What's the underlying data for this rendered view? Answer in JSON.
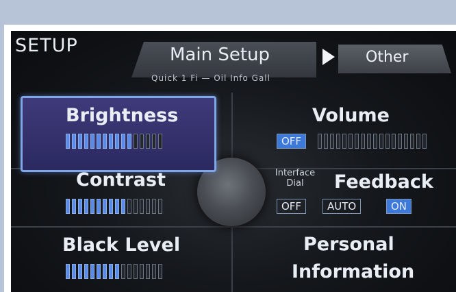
{
  "header": {
    "title": "SETUP",
    "tab_main_label": "Main Setup",
    "tab_main_sub": "Quick 1 Fi  —  Oil Info  Gall",
    "tab_other_label": "Other"
  },
  "settings": {
    "brightness": {
      "label": "Brightness",
      "level": 0.69
    },
    "contrast": {
      "label": "Contrast",
      "level": 0.62
    },
    "black_level": {
      "label": "Black Level",
      "level": 0.58
    },
    "volume": {
      "label": "Volume",
      "level": 0,
      "status": "OFF"
    },
    "feedback": {
      "label": "Feedback",
      "interface_dial": "Interface\nDial",
      "options": [
        "OFF",
        "AUTO",
        "ON"
      ],
      "selected": "ON"
    },
    "personal": {
      "line1": "Personal",
      "line2": "Information"
    }
  },
  "colors": {
    "accent": "#5b8be8",
    "selected_bg": "#3f3a7a",
    "active_badge": "#3d79d8"
  }
}
